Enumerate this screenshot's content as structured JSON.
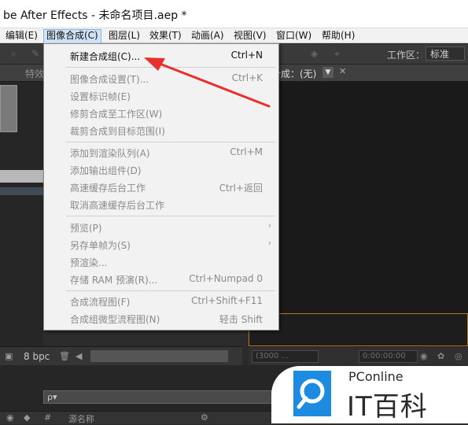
{
  "window": {
    "title": "be After Effects - 未命名项目.aep *"
  },
  "menubar": {
    "items": [
      {
        "label": "编辑(E)"
      },
      {
        "label": "图像合成(C)"
      },
      {
        "label": "图层(L)"
      },
      {
        "label": "效果(T)"
      },
      {
        "label": "动画(A)"
      },
      {
        "label": "视图(V)"
      },
      {
        "label": "窗口(W)"
      },
      {
        "label": "帮助(H)"
      }
    ],
    "active_item": "图像合成(C)"
  },
  "toolbar": {
    "workspace_label": "工作区：",
    "workspace_value": "标准"
  },
  "panels": {
    "effects_tab_label": "特效",
    "composition_tab_label": "合成：(无)",
    "project_bpc": "8 bpc",
    "viewer_resolution": "(3000 ...",
    "viewer_timecode": "0:00:00:00",
    "timeline_search_placeholder": "ρ▾",
    "timeline_source_name": "源名称"
  },
  "dropdown": {
    "items": [
      {
        "label": "新建合成组(C)...",
        "shortcut": "Ctrl+N",
        "enabled": true,
        "submenu": false
      },
      {
        "label": "图像合成设置(T)...",
        "shortcut": "Ctrl+K",
        "enabled": false,
        "submenu": false
      },
      {
        "label": "设置标识帧(E)",
        "shortcut": "",
        "enabled": false,
        "submenu": false
      },
      {
        "label": "修剪合成至工作区(W)",
        "shortcut": "",
        "enabled": false,
        "submenu": false
      },
      {
        "label": "裁剪合成到目标范围(I)",
        "shortcut": "",
        "enabled": false,
        "submenu": false
      },
      {
        "label": "添加到渲染队列(A)",
        "shortcut": "Ctrl+M",
        "enabled": false,
        "submenu": false
      },
      {
        "label": "添加输出组件(D)",
        "shortcut": "",
        "enabled": false,
        "submenu": false
      },
      {
        "label": "高速缓存后台工作",
        "shortcut": "Ctrl+返回",
        "enabled": false,
        "submenu": false
      },
      {
        "label": "取消高速缓存后台工作",
        "shortcut": "",
        "enabled": false,
        "submenu": false
      },
      {
        "label": "预览(P)",
        "shortcut": "",
        "enabled": false,
        "submenu": true
      },
      {
        "label": "另存单帧为(S)",
        "shortcut": "",
        "enabled": false,
        "submenu": true
      },
      {
        "label": "预渲染...",
        "shortcut": "",
        "enabled": false,
        "submenu": false
      },
      {
        "label": "存储 RAM 预演(R)...",
        "shortcut": "Ctrl+Numpad 0",
        "enabled": false,
        "submenu": false
      },
      {
        "label": "合成流程图(F)",
        "shortcut": "Ctrl+Shift+F11",
        "enabled": false,
        "submenu": false
      },
      {
        "label": "合成组微型流程图(N)",
        "shortcut": "轻击 Shift",
        "enabled": false,
        "submenu": false
      }
    ]
  },
  "watermark": {
    "site": "PConline",
    "brand": "IT百科"
  },
  "colors": {
    "annotation_arrow": "#e8302e",
    "menu_highlight": "#cfe3f7",
    "comp_frame": "#b87a1c"
  },
  "icons": [
    "search-icon",
    "trash-icon",
    "folder-icon",
    "chevron-down-icon",
    "close-icon",
    "chevron-right-icon",
    "camera-icon",
    "pconline-logo-icon"
  ]
}
